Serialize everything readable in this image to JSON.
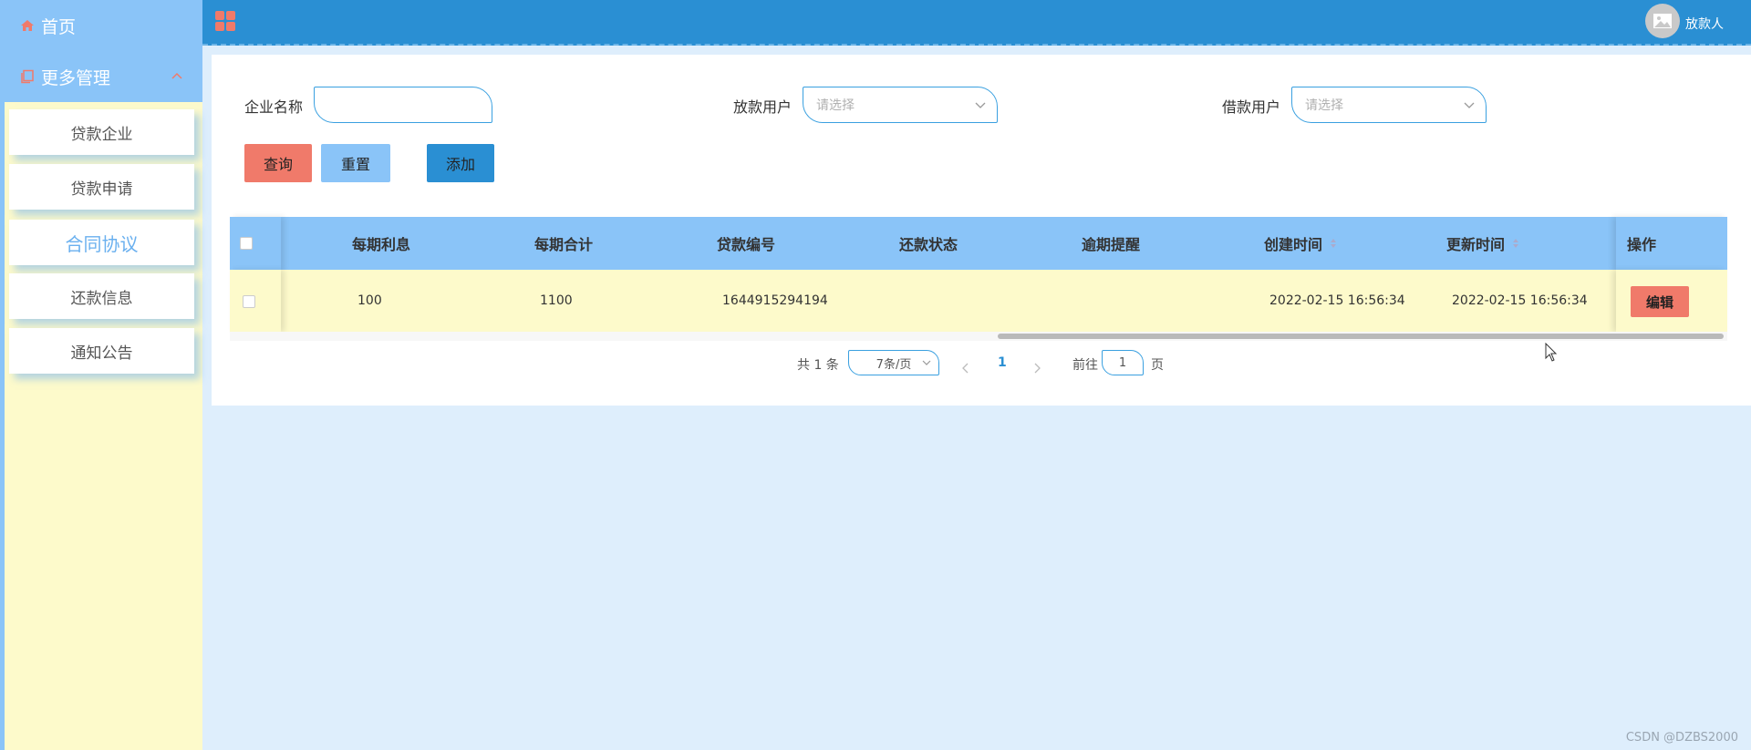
{
  "sidebar": {
    "home_label": "首页",
    "group_label": "更多管理",
    "items": [
      {
        "label": "贷款企业"
      },
      {
        "label": "贷款申请"
      },
      {
        "label": "合同协议"
      },
      {
        "label": "还款信息"
      },
      {
        "label": "通知公告"
      }
    ],
    "active_index": 2
  },
  "topbar": {
    "user_name": "放款人"
  },
  "filters": {
    "company_label": "企业名称",
    "company_value": "",
    "lender_label": "放款用户",
    "lender_placeholder": "请选择",
    "borrower_label": "借款用户",
    "borrower_placeholder": "请选择"
  },
  "buttons": {
    "query": "查询",
    "reset": "重置",
    "add": "添加"
  },
  "table": {
    "columns": [
      "每期利息",
      "每期合计",
      "贷款编号",
      "还款状态",
      "逾期提醒",
      "创建时间",
      "更新时间",
      "操作"
    ],
    "rows": [
      {
        "interest": "100",
        "total": "1100",
        "loan_no": "1644915294194",
        "repay_status": "",
        "overdue": "",
        "created": "2022-02-15 16:56:34",
        "updated": "2022-02-15 16:56:34",
        "action": "编辑"
      }
    ]
  },
  "pagination": {
    "total_text": "共 1 条",
    "page_size": "7条/页",
    "current_page": "1",
    "goto_label": "前往",
    "goto_value": "1",
    "page_suffix": "页"
  },
  "watermark": "CSDN @DZBS2000",
  "colors": {
    "sidebar_bg": "#fdfacb",
    "sidebar_accent": "#8ac4f8",
    "topbar": "#2a8fd3",
    "query_btn": "#f07a6a",
    "reset_btn": "#8ac4f8",
    "add_btn": "#2a8fd3",
    "edit_btn": "#f07a6a"
  }
}
